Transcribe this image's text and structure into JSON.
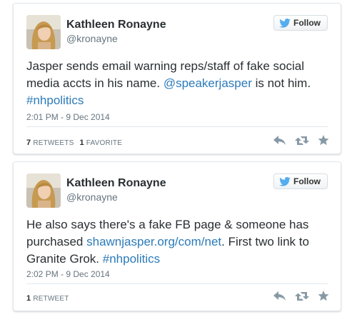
{
  "colors": {
    "link": "#2b7bb9",
    "text": "#292f33",
    "muted": "#66757f",
    "twitter_blue": "#55acee",
    "action_gray": "#8899a6"
  },
  "icons": {
    "follow": "twitter-bird-icon",
    "reply": "reply-icon",
    "retweet": "retweet-icon",
    "favorite": "star-icon"
  },
  "tweets": [
    {
      "author": {
        "name": "Kathleen Ronayne",
        "handle": "@kronayne"
      },
      "follow_label": "Follow",
      "text_parts": {
        "t1": "Jasper sends email warning reps/staff of fake social media accts in his name. ",
        "mention": "@speakerjasper",
        "t2": " is not him.",
        "hashtag": "#nhpolitics"
      },
      "timestamp": "2:01 PM - 9 Dec 2014",
      "stats": {
        "retweets_count": "7",
        "retweets_label": "RETWEETS",
        "favorites_count": "1",
        "favorites_label": "FAVORITE"
      }
    },
    {
      "author": {
        "name": "Kathleen Ronayne",
        "handle": "@kronayne"
      },
      "follow_label": "Follow",
      "text_parts": {
        "t1": "He also says there's a fake FB page & someone has purchased ",
        "url": "shawnjasper.org/com/net",
        "t2": ". First two link to Granite Grok. ",
        "hashtag": "#nhpolitics"
      },
      "timestamp": "2:02 PM - 9 Dec 2014",
      "stats": {
        "retweets_count": "1",
        "retweets_label": "RETWEET"
      }
    }
  ]
}
